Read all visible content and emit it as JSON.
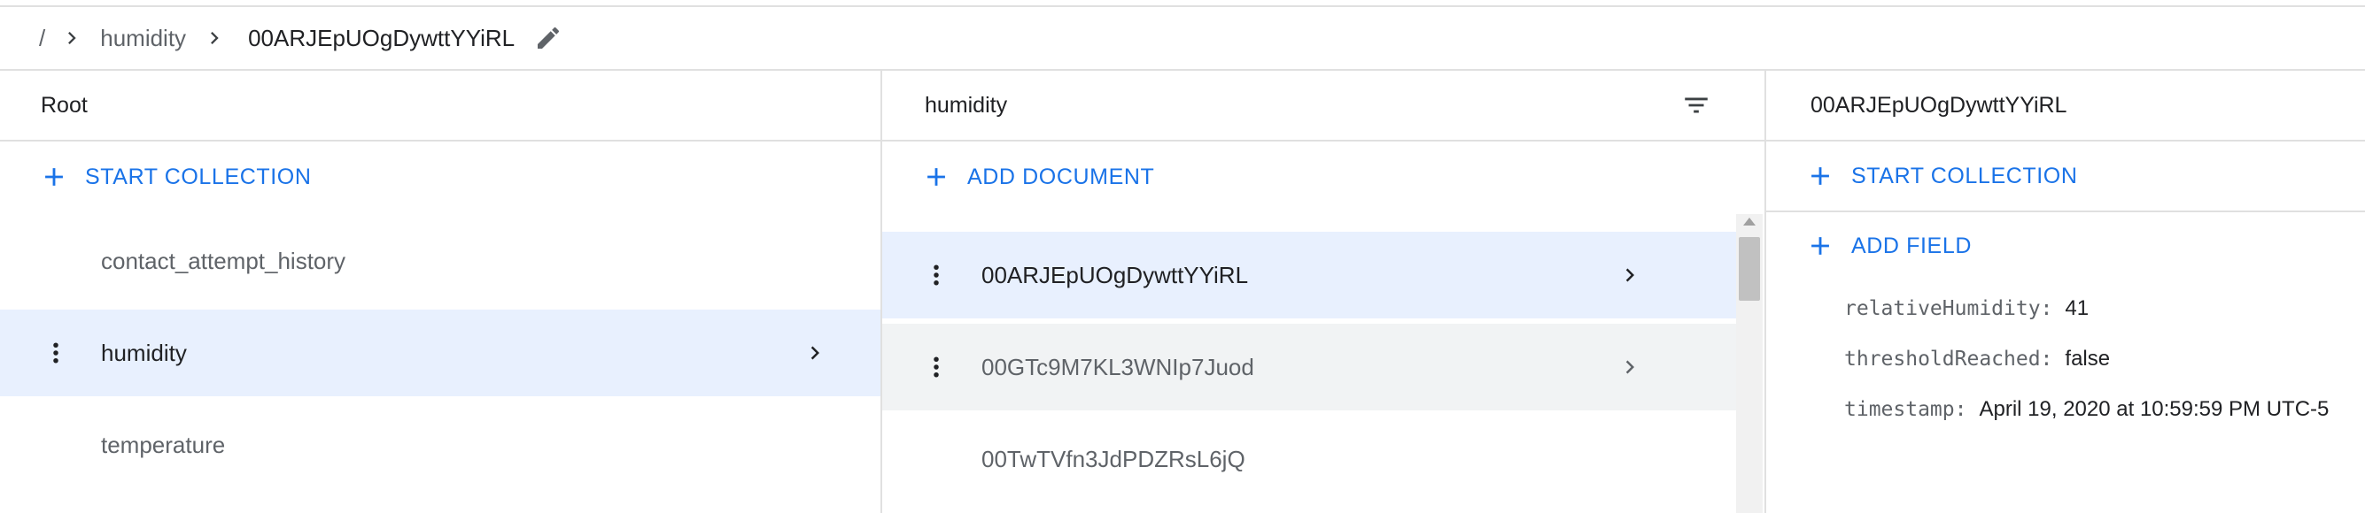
{
  "breadcrumb": {
    "root": "/",
    "collection": "humidity",
    "document": "00ARJEpUOgDywttYYiRL"
  },
  "panels": {
    "root": {
      "title": "Root",
      "action_label": "START COLLECTION",
      "items": [
        {
          "label": "contact_attempt_history",
          "selected": false
        },
        {
          "label": "humidity",
          "selected": true
        },
        {
          "label": "temperature",
          "selected": false
        }
      ]
    },
    "collection": {
      "title": "humidity",
      "action_label": "ADD DOCUMENT",
      "items": [
        {
          "label": "00ARJEpUOgDywttYYiRL",
          "selected": true
        },
        {
          "label": "00GTc9M7KL3WNIp7Juod",
          "selected": false,
          "hover": true
        },
        {
          "label": "00TwTVfn3JdPDZRsL6jQ",
          "selected": false
        }
      ]
    },
    "document": {
      "title": "00ARJEpUOgDywttYYiRL",
      "action_label": "START COLLECTION",
      "add_field_label": "ADD FIELD",
      "fields": [
        {
          "key": "relativeHumidity:",
          "value": "41"
        },
        {
          "key": "thresholdReached:",
          "value": "false"
        },
        {
          "key": "timestamp:",
          "value": "April 19, 2020 at 10:59:59 PM UTC-5"
        }
      ]
    }
  },
  "colors": {
    "accent": "#1a73e8",
    "selected_bg": "#e8f0fe",
    "hover_bg": "#f1f3f4",
    "divider": "#e0e0e0"
  },
  "icons": {
    "breadcrumb_separator": "chevron-right-icon",
    "edit": "pencil-icon",
    "filter": "filter-list-icon",
    "add": "plus-icon",
    "menu": "more-vert-icon",
    "open": "chevron-right-icon"
  }
}
